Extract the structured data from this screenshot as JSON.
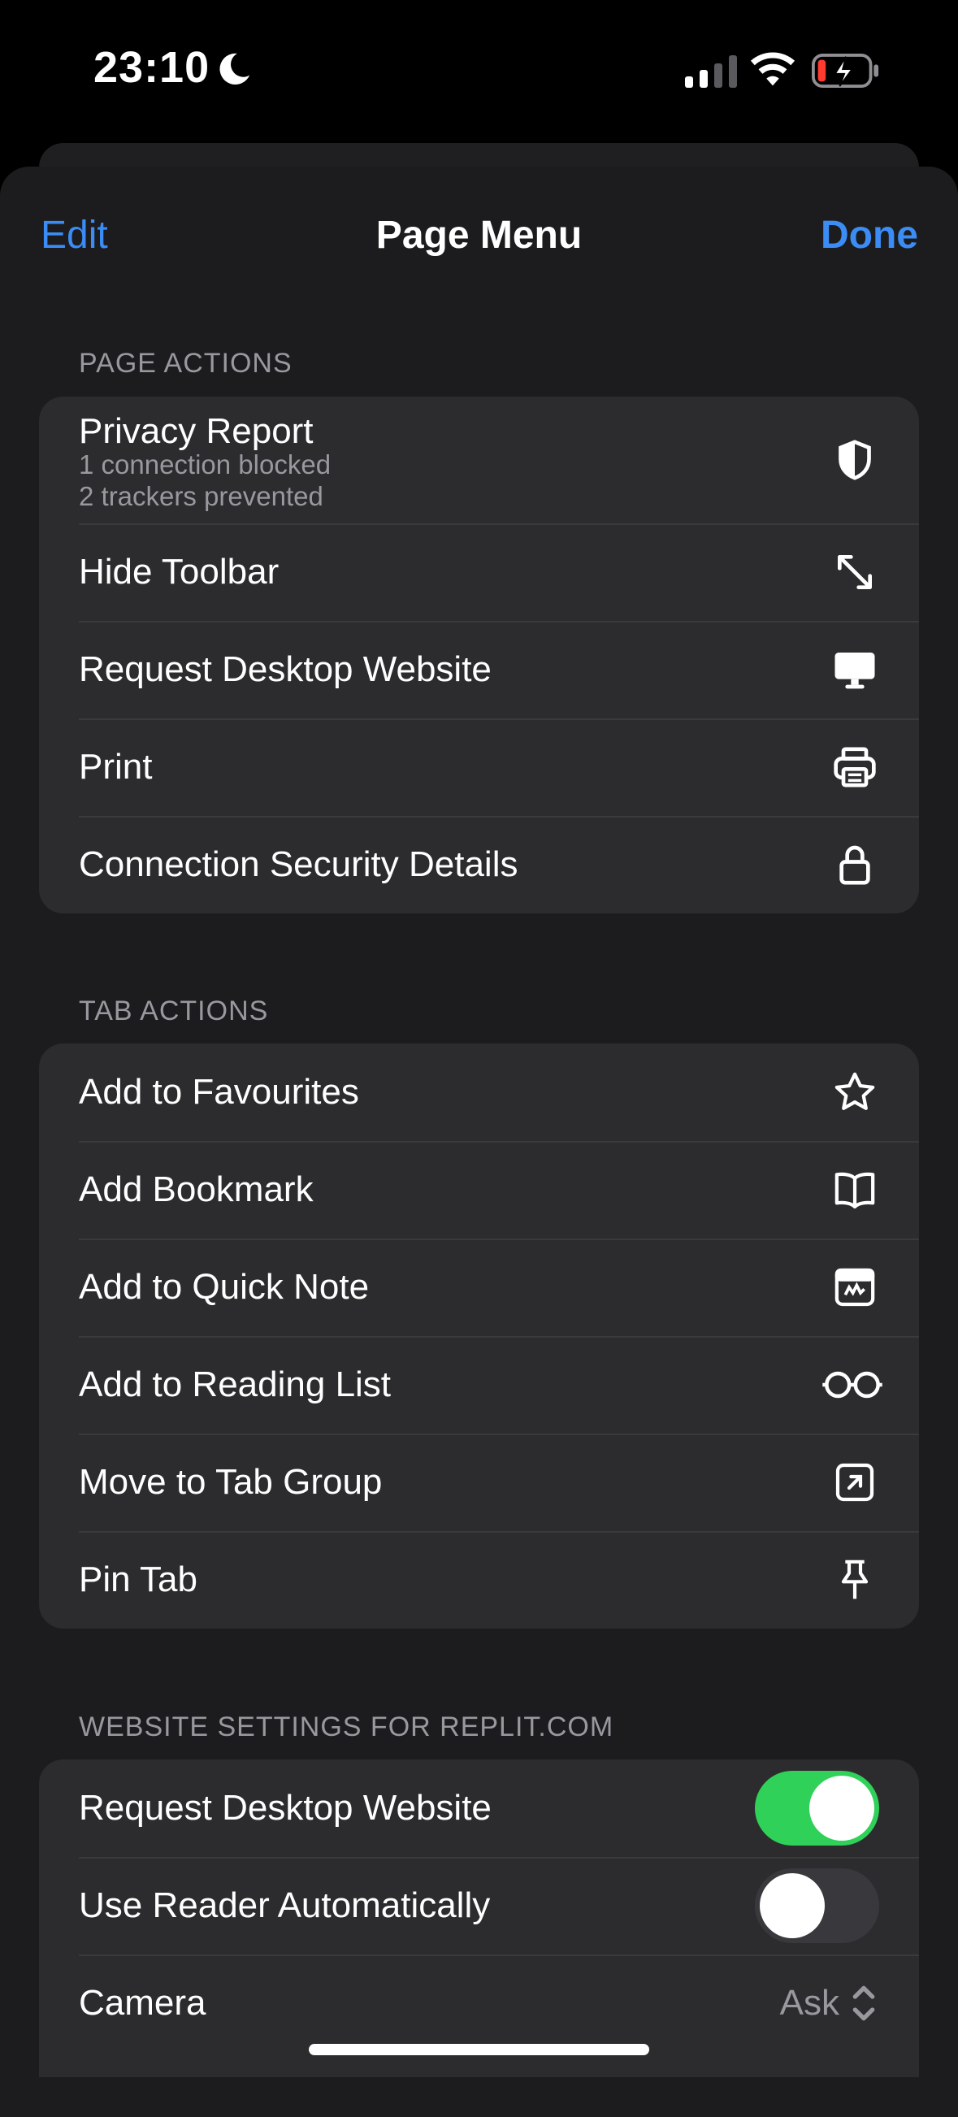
{
  "status_bar": {
    "time": "23:10"
  },
  "nav": {
    "edit_label": "Edit",
    "title": "Page Menu",
    "done_label": "Done"
  },
  "page_actions": {
    "header": "PAGE ACTIONS",
    "privacy": {
      "label": "Privacy Report",
      "line1": "1 connection blocked",
      "line2": "2 trackers prevented",
      "icon": "shield-icon"
    },
    "items": [
      {
        "label": "Hide Toolbar",
        "icon": "expand-arrows-icon"
      },
      {
        "label": "Request Desktop Website",
        "icon": "desktop-icon"
      },
      {
        "label": "Print",
        "icon": "printer-icon"
      },
      {
        "label": "Connection Security Details",
        "icon": "lock-icon"
      }
    ]
  },
  "tab_actions": {
    "header": "TAB ACTIONS",
    "items": [
      {
        "label": "Add to Favourites",
        "icon": "star-icon"
      },
      {
        "label": "Add Bookmark",
        "icon": "book-icon"
      },
      {
        "label": "Add to Quick Note",
        "icon": "quick-note-icon"
      },
      {
        "label": "Add to Reading List",
        "icon": "glasses-icon"
      },
      {
        "label": "Move to Tab Group",
        "icon": "tab-group-icon"
      },
      {
        "label": "Pin Tab",
        "icon": "pin-icon"
      }
    ]
  },
  "website_settings": {
    "header": "WEBSITE SETTINGS FOR REPLIT.COM",
    "request_desktop": {
      "label": "Request Desktop Website",
      "on": true
    },
    "use_reader": {
      "label": "Use Reader Automatically",
      "on": false
    },
    "camera": {
      "label": "Camera",
      "value": "Ask"
    }
  },
  "colors": {
    "accent": "#3b8cf5",
    "toggle_on": "#30d158",
    "group_bg": "#2c2c2e",
    "sheet_bg": "#1c1c1e"
  }
}
